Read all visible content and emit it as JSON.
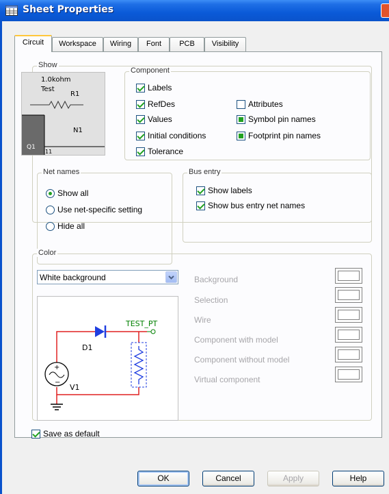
{
  "window": {
    "title": "Sheet Properties",
    "accent_color": "#0a53cc"
  },
  "tabs": [
    {
      "label": "Circuit",
      "active": true
    },
    {
      "label": "Workspace"
    },
    {
      "label": "Wiring"
    },
    {
      "label": "Font"
    },
    {
      "label": "PCB"
    },
    {
      "label": "Visibility"
    }
  ],
  "show": {
    "label": "Show",
    "preview": {
      "value": "1.0kohm",
      "name": "Test",
      "resistor_ref": "R1",
      "net": "N1",
      "part_ref": "Q1",
      "pin": "11"
    }
  },
  "component": {
    "label": "Component",
    "items": [
      {
        "label": "Labels",
        "state": "checked"
      },
      {
        "label": "RefDes",
        "state": "checked"
      },
      {
        "label": "Values",
        "state": "checked"
      },
      {
        "label": "Initial conditions",
        "state": "checked"
      },
      {
        "label": "Tolerance",
        "state": "checked"
      },
      {
        "label": "Attributes",
        "state": "unchecked"
      },
      {
        "label": "Symbol pin names",
        "state": "indeterminate"
      },
      {
        "label": "Footprint pin names",
        "state": "indeterminate"
      }
    ]
  },
  "net_names": {
    "label": "Net names",
    "options": [
      {
        "label": "Show all",
        "selected": true
      },
      {
        "label": "Use net-specific setting",
        "selected": false
      },
      {
        "label": "Hide all",
        "selected": false
      }
    ]
  },
  "bus_entry": {
    "label": "Bus entry",
    "items": [
      {
        "label": "Show labels",
        "state": "checked"
      },
      {
        "label": "Show bus entry net names",
        "state": "checked"
      }
    ]
  },
  "color": {
    "label": "Color",
    "scheme": "White background",
    "items": [
      {
        "label": "Background"
      },
      {
        "label": "Selection"
      },
      {
        "label": "Wire"
      },
      {
        "label": "Component with model"
      },
      {
        "label": "Component without model"
      },
      {
        "label": "Virtual component"
      }
    ],
    "circuit": {
      "diode_ref": "D1",
      "net_label": "TEST_PT",
      "source_ref": "V1",
      "wire_color": "#e02020",
      "part_color": "#1f3ee0",
      "label_color": "#008000"
    }
  },
  "save_default": {
    "label": "Save as default",
    "state": "checked"
  },
  "buttons": {
    "ok": "OK",
    "cancel": "Cancel",
    "apply": "Apply",
    "help": "Help"
  }
}
